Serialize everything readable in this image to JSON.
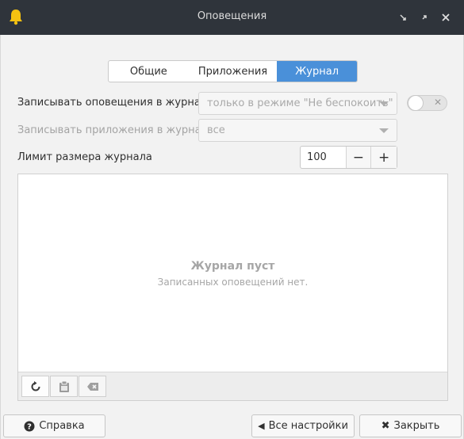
{
  "window": {
    "title": "Оповещения",
    "app_icon": "bell-icon",
    "controls": [
      "close-icon",
      "maximize-icon",
      "minimize-icon"
    ]
  },
  "tabs": [
    {
      "label": "Общие",
      "active": false
    },
    {
      "label": "Приложения",
      "active": false
    },
    {
      "label": "Журнал",
      "active": true
    }
  ],
  "settings": {
    "log_notifications": {
      "label": "Записывать оповещения в журнал",
      "value": "только в режиме \"Не беспокоить\"",
      "enabled": false
    },
    "log_apps": {
      "label": "Записывать приложения в журнал",
      "value": "все"
    },
    "log_limit": {
      "label": "Лимит размера журнала",
      "value": "100",
      "minus": "−",
      "plus": "+"
    }
  },
  "log": {
    "empty_title": "Журнал пуст",
    "empty_subtitle": "Записанных оповещений нет.",
    "toolbar": [
      "refresh-icon",
      "clipboard-icon",
      "clear-icon"
    ]
  },
  "footer": {
    "help": "Справка",
    "all_settings": "Все настройки",
    "close": "Закрыть"
  },
  "colors": {
    "accent": "#4a90d9",
    "titlebar": "#2f343b",
    "bell": "#f5c211"
  }
}
